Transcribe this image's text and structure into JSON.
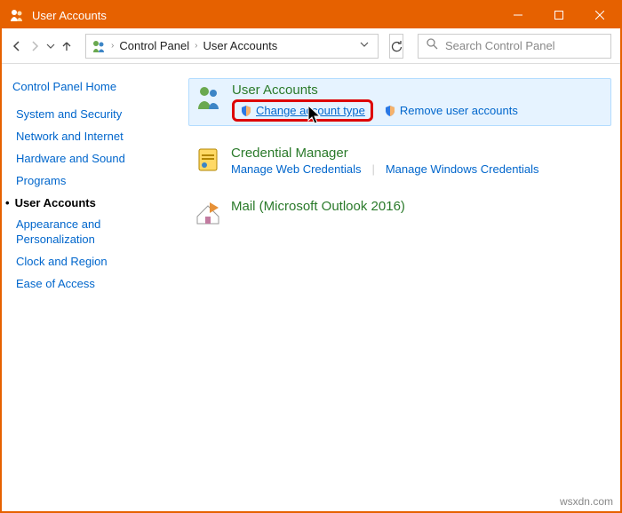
{
  "window": {
    "title": "User Accounts"
  },
  "breadcrumb": {
    "segments": [
      "Control Panel",
      "User Accounts"
    ]
  },
  "search": {
    "placeholder": "Search Control Panel"
  },
  "sidebar": {
    "home": "Control Panel Home",
    "items": [
      {
        "label": "System and Security",
        "active": false
      },
      {
        "label": "Network and Internet",
        "active": false
      },
      {
        "label": "Hardware and Sound",
        "active": false
      },
      {
        "label": "Programs",
        "active": false
      },
      {
        "label": "User Accounts",
        "active": true
      },
      {
        "label": "Appearance and Personalization",
        "active": false
      },
      {
        "label": "Clock and Region",
        "active": false
      },
      {
        "label": "Ease of Access",
        "active": false
      }
    ]
  },
  "categories": [
    {
      "title": "User Accounts",
      "highlight": true,
      "links": [
        {
          "label": "Change account type",
          "shield": true,
          "boxed": true
        },
        {
          "label": "Remove user accounts",
          "shield": true,
          "boxed": false
        }
      ]
    },
    {
      "title": "Credential Manager",
      "highlight": false,
      "links": [
        {
          "label": "Manage Web Credentials",
          "shield": false,
          "boxed": false
        },
        {
          "label": "Manage Windows Credentials",
          "shield": false,
          "boxed": false
        }
      ]
    },
    {
      "title": "Mail (Microsoft Outlook 2016)",
      "highlight": false,
      "links": []
    }
  ],
  "watermark": "wsxdn.com"
}
